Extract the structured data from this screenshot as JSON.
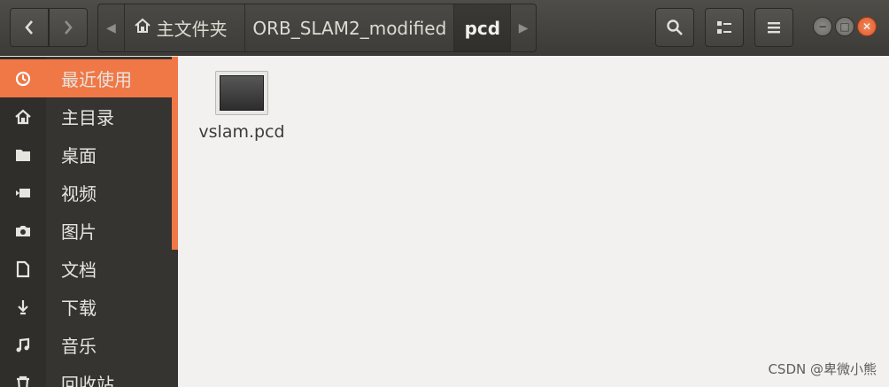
{
  "header": {
    "breadcrumbs": [
      {
        "label": "主文件夹",
        "icon": "home-icon"
      },
      {
        "label": "ORB_SLAM2_modified"
      },
      {
        "label": "pcd",
        "active": true
      }
    ]
  },
  "sidebar": {
    "items": [
      {
        "label": "最近使用",
        "icon": "recent-icon",
        "active": true
      },
      {
        "label": "主目录",
        "icon": "home-icon"
      },
      {
        "label": "桌面",
        "icon": "folder-icon"
      },
      {
        "label": "视频",
        "icon": "video-icon"
      },
      {
        "label": "图片",
        "icon": "camera-icon"
      },
      {
        "label": "文档",
        "icon": "document-icon"
      },
      {
        "label": "下载",
        "icon": "download-icon"
      },
      {
        "label": "音乐",
        "icon": "music-icon"
      },
      {
        "label": "回收站",
        "icon": "trash-icon"
      }
    ]
  },
  "main": {
    "files": [
      {
        "name": "vslam.pcd"
      }
    ]
  },
  "watermark": "CSDN @卑微小熊",
  "colors": {
    "accent": "#f07746",
    "sidebar": "#353431",
    "header": "#3c3b37"
  }
}
